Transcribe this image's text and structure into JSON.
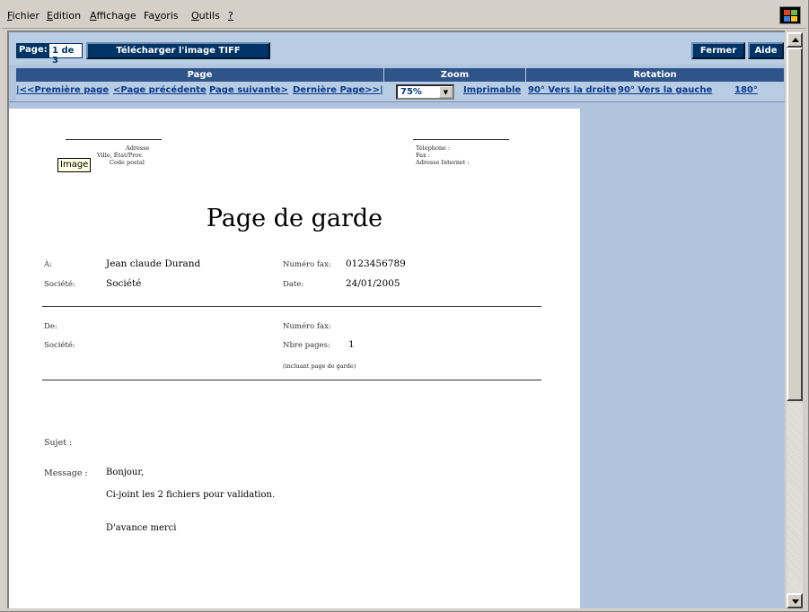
{
  "menu": [
    {
      "label_pre": "",
      "label_ul": "F",
      "label_post": "ichier"
    },
    {
      "label_pre": "",
      "label_ul": "E",
      "label_post": "dition"
    },
    {
      "label_pre": "",
      "label_ul": "A",
      "label_post": "ffichage"
    },
    {
      "label_pre": "Fa",
      "label_ul": "v",
      "label_post": "oris"
    },
    {
      "label_pre": "",
      "label_ul": "O",
      "label_post": "utils"
    },
    {
      "label_pre": "",
      "label_ul": "?",
      "label_post": ""
    }
  ],
  "toolbar": {
    "page_label": "Page:",
    "page_value": "1 de 3",
    "download_label": "Télécharger l'image TIFF",
    "close_label": "Fermer",
    "help_label": "Aide"
  },
  "nav": {
    "headers": {
      "page": "Page",
      "zoom": "Zoom",
      "rotation": "Rotation"
    },
    "first": "|<<Première page",
    "prev": "<Page précédente",
    "next": "Page suivante>",
    "last": "Dernière Page>>|",
    "zoom_value": "75%",
    "printable": "Imprimable",
    "rot_right": "90° Vers la droite",
    "rot_left": "90° Vers la gauche",
    "rot_180": "180°"
  },
  "doc": {
    "image_tooltip": "Image",
    "address": "Adresse",
    "city": "Ville, État/Prov.",
    "postal": "Code postal",
    "phone": "Téléphone :",
    "fax": "Fax :",
    "web": "Adresse Internet :",
    "title": "Page de garde",
    "to_label": "À:",
    "to_value": "Jean claude Durand",
    "fax_label": "Numéro fax:",
    "fax_value": "0123456789",
    "company_label": "Société:",
    "company_value": "Société",
    "date_label": "Date:",
    "date_value": "24/01/2005",
    "from_label": "De:",
    "from_fax_label": "Numéro fax:",
    "from_company_label": "Société:",
    "pages_label": "Nbre pages:",
    "pages_value": "1",
    "pages_note": "(incluant page de garde)",
    "subject_label": "Sujet :",
    "message_label": "Message :",
    "message_lines": [
      "Bonjour,",
      "Ci-joint les 2 fichiers pour validation.",
      "D'avance merci"
    ]
  },
  "colors": {
    "navy": "#003366",
    "toolbar_bg": "#b8cce4",
    "link": "#0a3a8a"
  }
}
